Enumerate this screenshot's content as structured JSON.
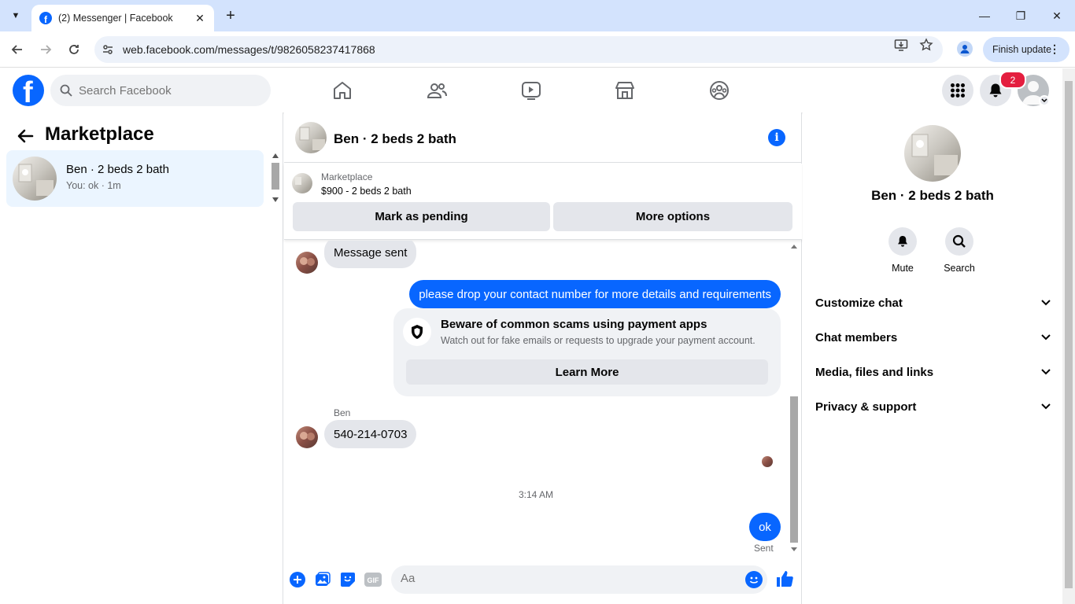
{
  "browser": {
    "tab_title": "(2) Messenger | Facebook",
    "url": "web.facebook.com/messages/t/9826058237417868",
    "finish_update": "Finish update"
  },
  "fb": {
    "search_placeholder": "Search Facebook",
    "notification_count": "2",
    "brand_color": "#0866ff"
  },
  "sidebar": {
    "heading": "Marketplace",
    "conversations": [
      {
        "name": "Ben · 2 beds 2 bath",
        "snippet": "You: ok · 1m"
      }
    ]
  },
  "chat": {
    "title": "Ben · 2 beds 2 bath",
    "listing": {
      "label": "Marketplace",
      "price_title": "$900 - 2 beds 2 bath",
      "mark_pending": "Mark as pending",
      "more_options": "More options"
    },
    "messages": {
      "first_in": "Message sent",
      "out_request": "please drop your contact number for more details and requirements",
      "scam_title": "Beware of common scams using payment apps",
      "scam_desc": "Watch out for fake emails or requests to upgrade your payment account.",
      "learn_more": "Learn More",
      "sender": "Ben",
      "phone": "540-214-0703",
      "timestamp": "3:14 AM",
      "last_out": "ok",
      "status": "Sent"
    },
    "composer_placeholder": "Aa"
  },
  "details": {
    "name": "Ben · 2 beds 2 bath",
    "mute": "Mute",
    "search": "Search",
    "sections": [
      "Customize chat",
      "Chat members",
      "Media, files and links",
      "Privacy & support"
    ]
  }
}
